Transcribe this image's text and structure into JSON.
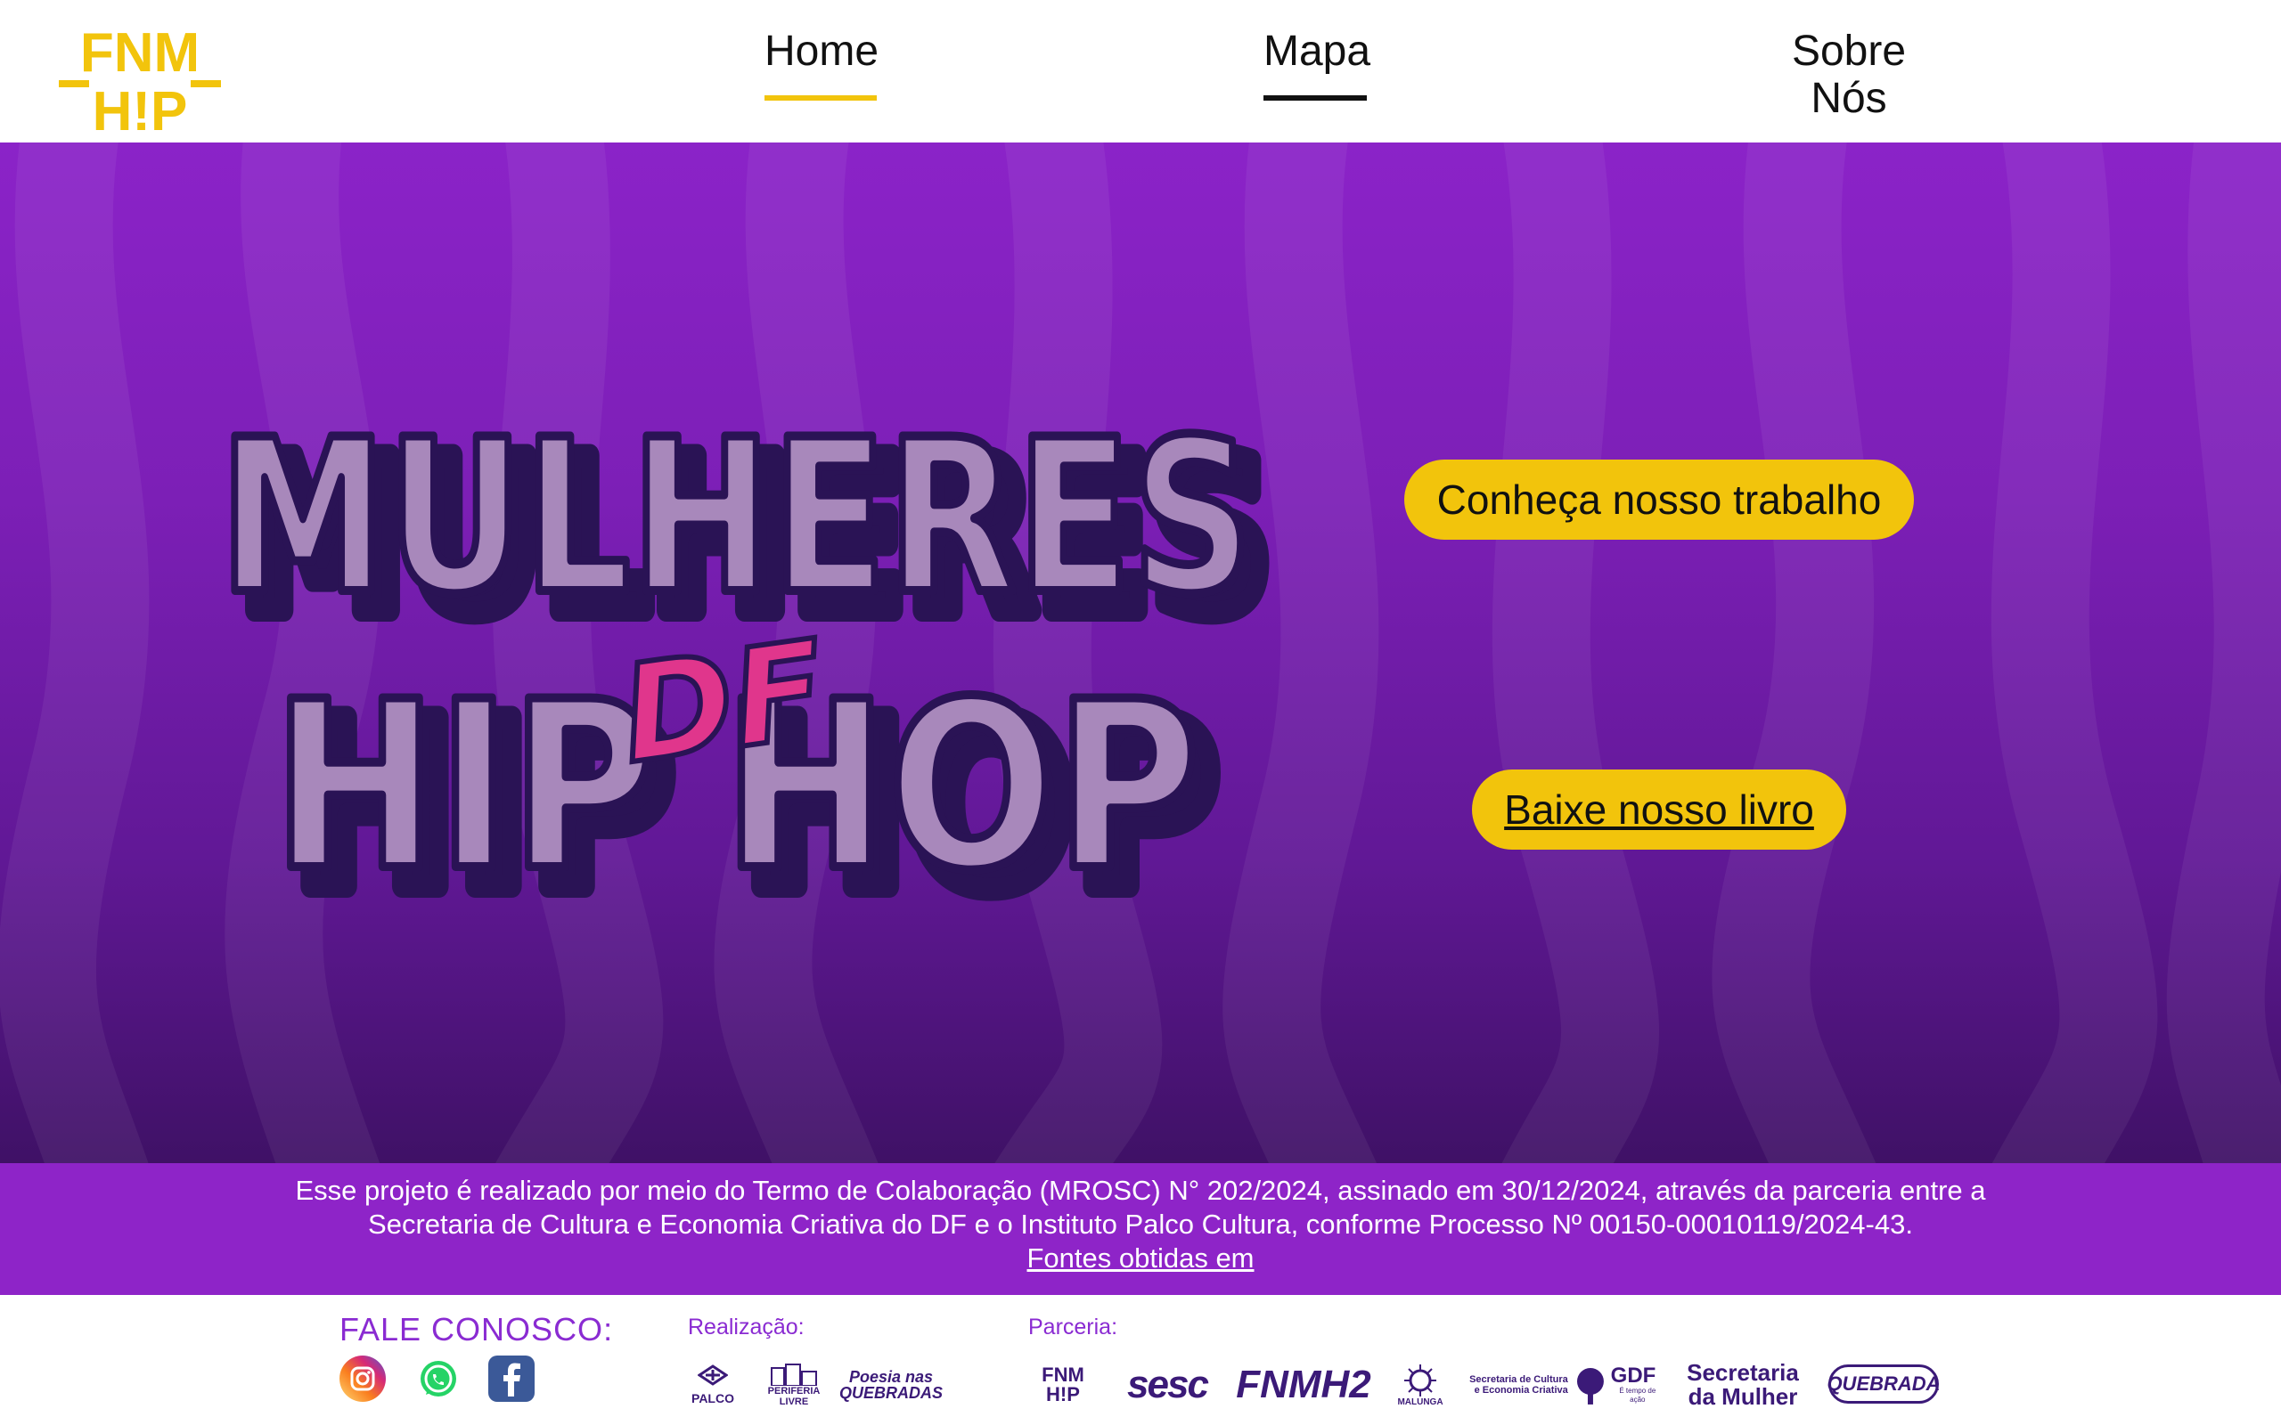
{
  "brand": {
    "logo_top": "FNM",
    "logo_bottom": "H!P",
    "logo_color": "#f2c40c"
  },
  "nav": {
    "items": [
      {
        "label": "Home",
        "active": true
      },
      {
        "label": "Mapa",
        "active": false
      },
      {
        "label": "Sobre Nós",
        "active": false
      }
    ]
  },
  "hero": {
    "title_line1": "MULHERES",
    "title_middle": "DF",
    "title_line2": "HIP HOP",
    "cta_primary": "Conheça nosso trabalho",
    "cta_secondary": "Baixe nosso livro"
  },
  "notice": {
    "line1": "Esse projeto é realizado por meio do Termo de Colaboração (MROSC) N° 202/2024, assinado em 30/12/2024, através da parceria entre a",
    "line2": "Secretaria de Cultura e Economia Criativa do DF e o Instituto Palco Cultura, conforme Processo Nº 00150-00010119/2024-43.",
    "link": "Fontes obtidas em"
  },
  "footer": {
    "contact_title": "FALE CONOSCO:",
    "social": [
      "instagram-icon",
      "whatsapp-icon",
      "facebook-icon"
    ],
    "realizacao_label": "Realização:",
    "realizacao": [
      "PALCO",
      "PERIFERIA LIVRE",
      "Poesia nas QUEBRADAS"
    ],
    "parceria_label": "Parceria:",
    "parceria": [
      "FNM H!P",
      "sesc",
      "FNMH2",
      "MALUNGA",
      "Secretaria de Cultura e Economia Criativa",
      "GDF",
      "É tempo de ação",
      "Secretaria",
      "da Mulher",
      "QUEBRADA"
    ]
  },
  "colors": {
    "accent": "#f2c40c",
    "purple": "#8e24c8",
    "lilac": "#a888bb",
    "pink": "#e0368c"
  }
}
